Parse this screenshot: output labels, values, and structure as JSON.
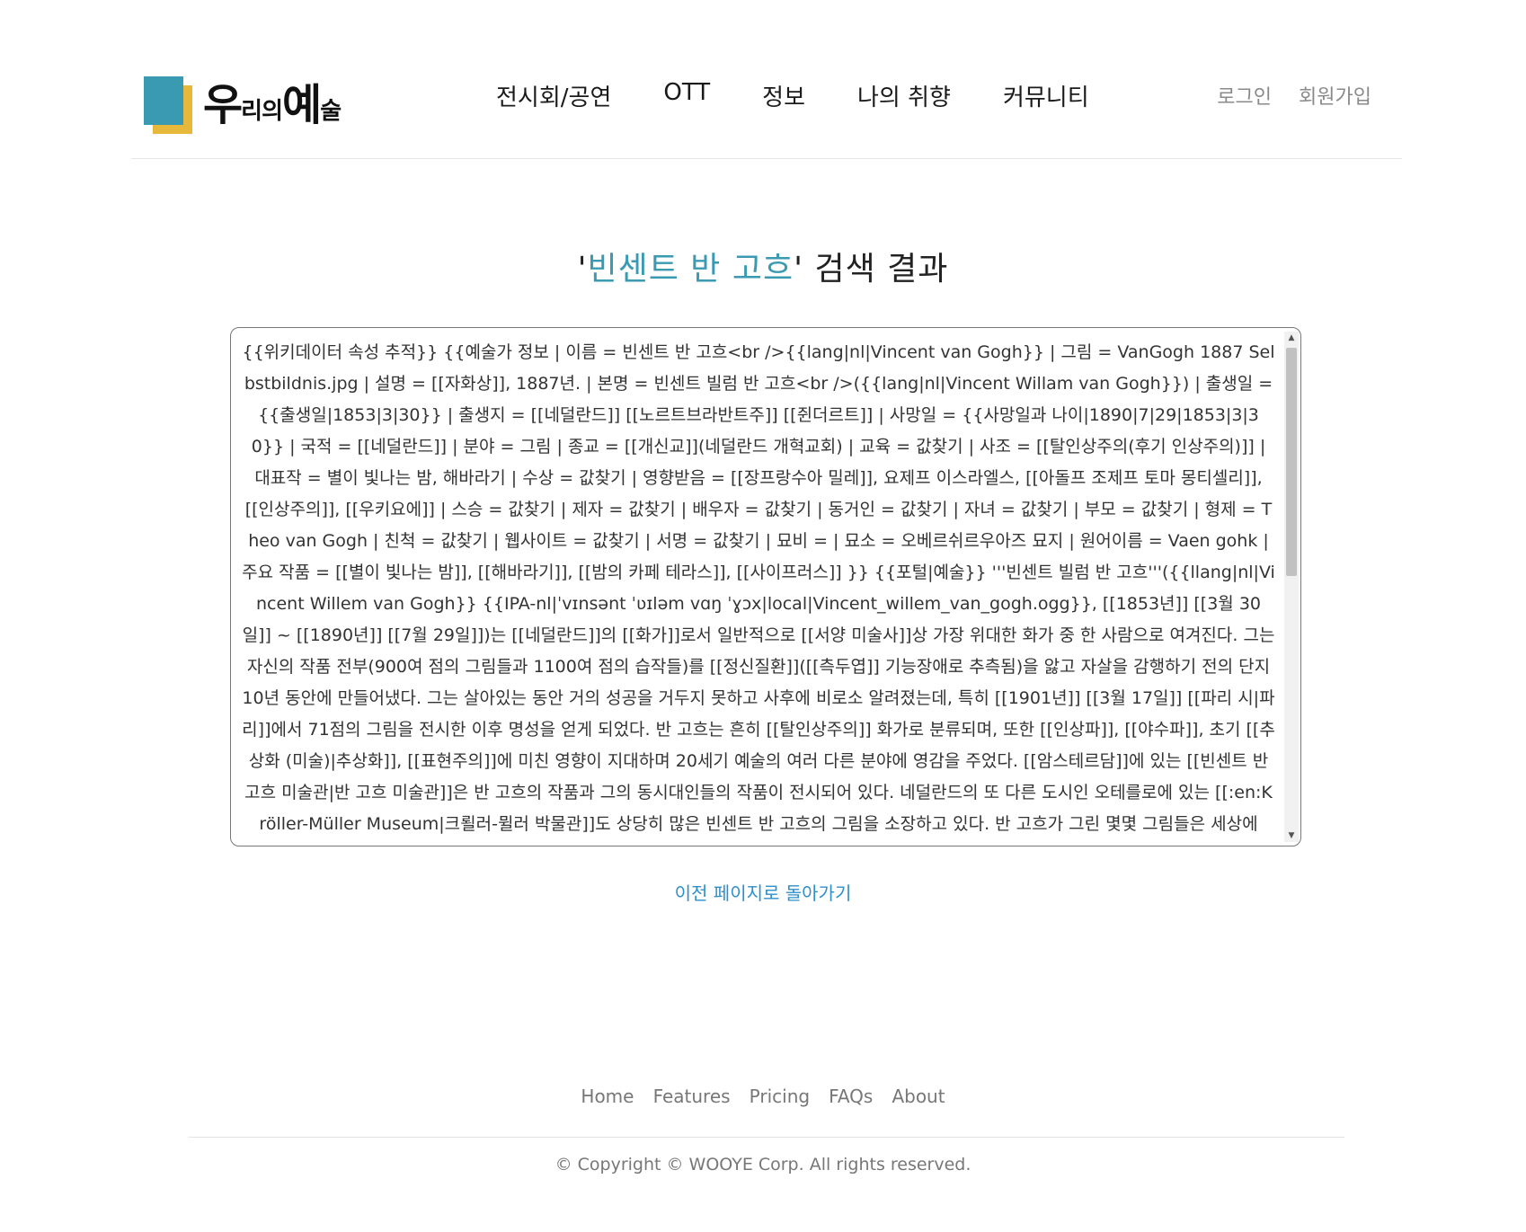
{
  "header": {
    "logo": {
      "part1": "우",
      "part2": "리의",
      "part3": "예",
      "part4": "술"
    },
    "nav": [
      "전시회/공연",
      "OTT",
      "정보",
      "나의 취향",
      "커뮤니티"
    ],
    "auth": {
      "login": "로그인",
      "signup": "회원가입"
    }
  },
  "result": {
    "quote_open": "'",
    "query": "빈센트 반 고흐",
    "quote_close": "'",
    "suffix": " 검색 결과",
    "content": "{{위키데이터 속성 추적}} {{예술가 정보 | 이름 = 빈센트 반 고흐<br />{{lang|nl|Vincent van Gogh}} | 그림 = VanGogh 1887 Selbstbildnis.jpg | 설명 = [[자화상]], 1887년. | 본명 = 빈센트 빌럼 반 고흐<br />({{lang|nl|Vincent Willam van Gogh}}) | 출생일 = {{출생일|1853|3|30}} | 출생지 = [[네덜란드]] [[노르트브라반트주]] [[쥔더르트]] | 사망일 = {{사망일과 나이|1890|7|29|1853|3|30}} | 국적 = [[네덜란드]] | 분야 = 그림 | 종교 = [[개신교]](네덜란드 개혁교회) | 교육 = 값찾기 | 사조 = [[탈인상주의(후기 인상주의)]] | 대표작 = 별이 빛나는 밤, 해바라기 | 수상 = 값찾기 | 영향받음 = [[장프랑수아 밀레]], 요제프 이스라엘스, [[아돌프 조제프 토마 몽티셀리]], [[인상주의]], [[우키요에]] | 스승 = 값찾기 | 제자 = 값찾기 | 배우자 = 값찾기 | 동거인 = 값찾기 | 자녀 = 값찾기 | 부모 = 값찾기 | 형제 = Theo van Gogh | 친척 = 값찾기 | 웹사이트 = 값찾기 | 서명 = 값찾기 | 묘비 = | 묘소 = 오베르쉬르우아즈 묘지 | 원어이름 = Vaen gohk | 주요 작품 = [[별이 빛나는 밤]], [[해바라기]], [[밤의 카페 테라스]], [[사이프러스]] }} {{포털|예술}} '''빈센트 빌럼 반 고흐'''({{llang|nl|Vincent Willem van Gogh}} {{IPA-nl|ˈvɪnsənt ˈʋɪləm vɑŋ ˈɣɔx|local|Vincent_willem_van_gogh.ogg}}, [[1853년]] [[3월 30일]] ~ [[1890년]] [[7월 29일]])는 [[네덜란드]]의 [[화가]]로서 일반적으로 [[서양 미술사]]상 가장 위대한 화가 중 한 사람으로 여겨진다. 그는 자신의 작품 전부(900여 점의 그림들과 1100여 점의 습작들)를 [[정신질환]]([[측두엽]] 기능장애로 추측됨)을 앓고 자살을 감행하기 전의 단지 10년 동안에 만들어냈다. 그는 살아있는 동안 거의 성공을 거두지 못하고 사후에 비로소 알려졌는데, 특히 [[1901년]] [[3월 17일]] [[파리 시|파리]]에서 71점의 그림을 전시한 이후 명성을 얻게 되었다. 반 고흐는 흔히 [[탈인상주의]] 화가로 분류되며, 또한 [[인상파]], [[야수파]], 초기 [[추상화 (미술)|추상화]], [[표현주의]]에 미친 영향이 지대하며 20세기 예술의 여러 다른 분야에 영감을 주었다. [[암스테르담]]에 있는 [[빈센트 반 고흐 미술관|반 고흐 미술관]]은 반 고흐의 작품과 그의 동시대인들의 작품이 전시되어 있다. 네덜란드의 또 다른 도시인 오테를로에 있는 [[:en:Kröller-Müller Museum|크뢸러-뮐러 박물관]]도 상당히 많은 빈센트 반 고흐의 그림을 소장하고 있다. 반 고흐가 그린 몇몇 그림들은 세상에"
  },
  "back_link": "이전 페이지로 돌아가기",
  "footer": {
    "nav": [
      "Home",
      "Features",
      "Pricing",
      "FAQs",
      "About"
    ],
    "copyright": "© Copyright © WOOYE Corp. All rights reserved."
  },
  "colors": {
    "accent": "#3a9ab2",
    "logo_yellow": "#e8b83a",
    "link": "#2f8fc9"
  },
  "icons": {
    "scroll_up": "triangle-up",
    "scroll_down": "triangle-down"
  }
}
